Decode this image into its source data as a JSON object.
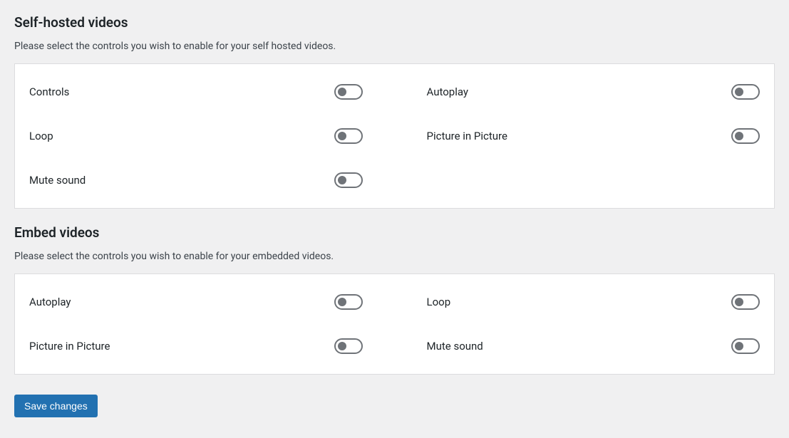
{
  "selfHosted": {
    "heading": "Self-hosted videos",
    "description": "Please select the controls you wish to enable for your self hosted videos.",
    "options": {
      "controls": "Controls",
      "autoplay": "Autoplay",
      "loop": "Loop",
      "pip": "Picture in Picture",
      "mute": "Mute sound"
    }
  },
  "embed": {
    "heading": "Embed videos",
    "description": "Please select the controls you wish to enable for your embedded videos.",
    "options": {
      "autoplay": "Autoplay",
      "loop": "Loop",
      "pip": "Picture in Picture",
      "mute": "Mute sound"
    }
  },
  "saveButton": "Save changes"
}
